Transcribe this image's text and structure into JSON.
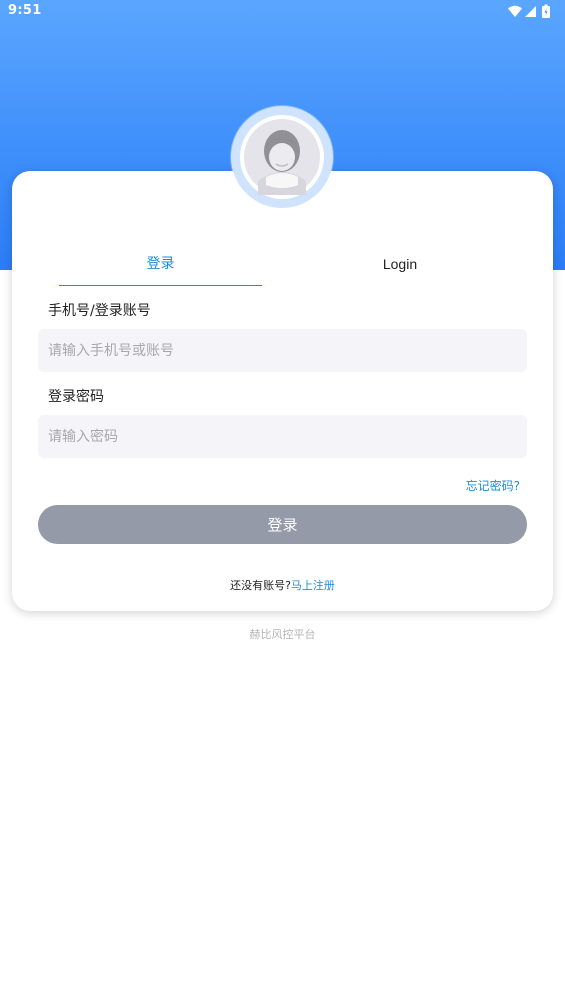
{
  "status_bar": {
    "time": "9:51",
    "icons": [
      "wifi-icon",
      "signal-icon",
      "battery-icon"
    ]
  },
  "avatar": {
    "icon": "user-avatar-icon"
  },
  "tabs": [
    {
      "label": "登录",
      "active": true
    },
    {
      "label": "Login",
      "active": false
    }
  ],
  "form": {
    "account_label": "手机号/登录账号",
    "account_placeholder": "请输入手机号或账号",
    "account_value": "",
    "password_label": "登录密码",
    "password_placeholder": "请输入密码",
    "password_value": "",
    "forgot_label": "忘记密码?",
    "submit_label": "登录"
  },
  "register": {
    "prompt": "还没有账号?",
    "link": "马上注册"
  },
  "footer": {
    "text": "赫比风控平台"
  },
  "colors": {
    "header_blue": "#3f8ffb",
    "accent": "#1e8bd8",
    "button_disabled": "#959aa8",
    "input_bg": "#f5f5f9"
  }
}
